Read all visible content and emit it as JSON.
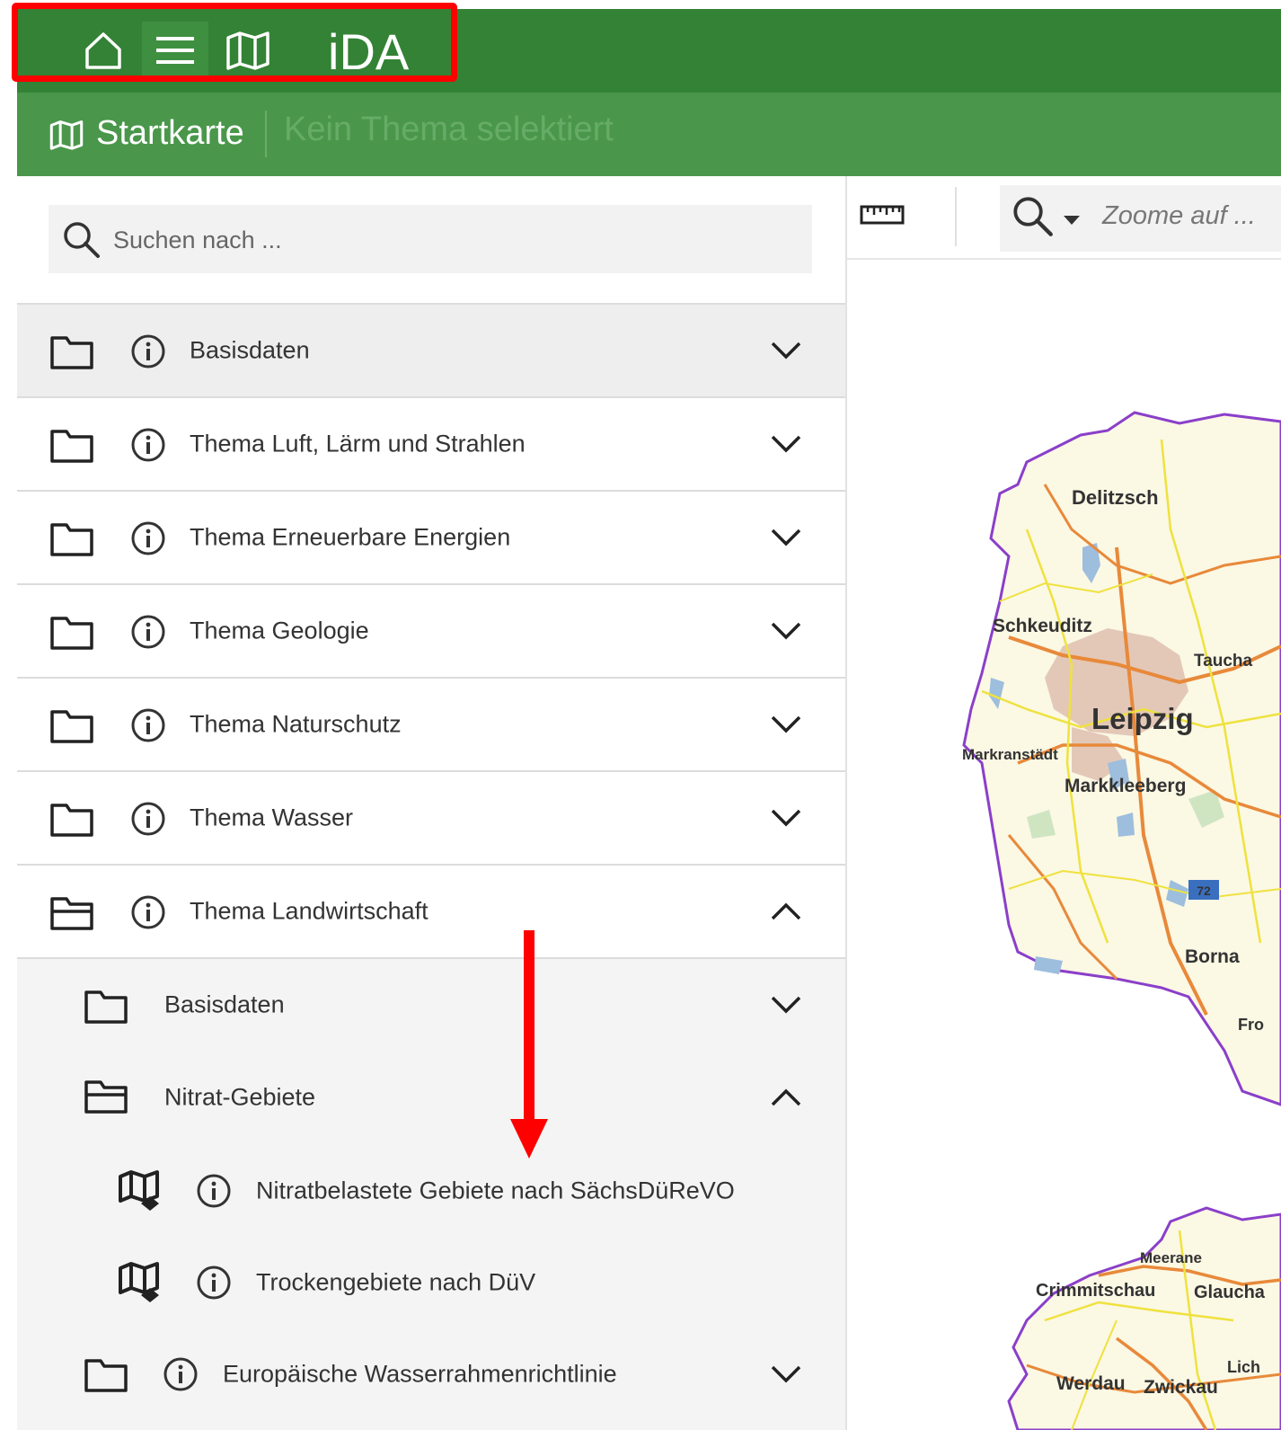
{
  "header": {
    "brand": "iDA",
    "home_icon": "home-icon",
    "menu_icon": "menu-icon",
    "map_icon": "map-icon",
    "bg_color": "#348235"
  },
  "subheader": {
    "map_name": "Startkarte",
    "theme_status": "Kein Thema selektiert",
    "bg_color": "#4a974b"
  },
  "search": {
    "placeholder": "Suchen nach ..."
  },
  "layer_tree": {
    "items": [
      {
        "label": "Basisdaten",
        "expanded": false
      },
      {
        "label": "Thema Luft, Lärm und Strahlen",
        "expanded": false
      },
      {
        "label": "Thema Erneuerbare Energien",
        "expanded": false
      },
      {
        "label": "Thema Geologie",
        "expanded": false
      },
      {
        "label": "Thema Naturschutz",
        "expanded": false
      },
      {
        "label": "Thema Wasser",
        "expanded": false
      },
      {
        "label": "Thema Landwirtschaft",
        "expanded": true
      }
    ],
    "landwirtschaft_children": [
      {
        "label": "Basisdaten",
        "expanded": false
      },
      {
        "label": "Nitrat-Gebiete",
        "expanded": true
      }
    ],
    "nitrat_layers": [
      {
        "label": "Nitratbelastete Gebiete nach SächsDüReVO"
      },
      {
        "label": "Trockengebiete nach DüV"
      }
    ],
    "other_children": [
      {
        "label": "Europäische Wasserrahmenrichtlinie",
        "expanded": false
      }
    ]
  },
  "toolbar": {
    "measure_icon": "ruler-icon",
    "zoom_placeholder": "Zoome auf ..."
  },
  "map": {
    "places_north": [
      "Delitzsch",
      "Schkeuditz",
      "Taucha",
      "Leipzig",
      "Markranstädt",
      "Markkleeberg",
      "72",
      "Borna",
      "Fro"
    ],
    "places_south": [
      "Meerane",
      "Crimmitschau",
      "Glaucha",
      "Werdau",
      "Zwickau",
      "Lich"
    ]
  },
  "annotations": {
    "highlight_color": "#ff0000",
    "arrow_color": "#ff0000"
  }
}
